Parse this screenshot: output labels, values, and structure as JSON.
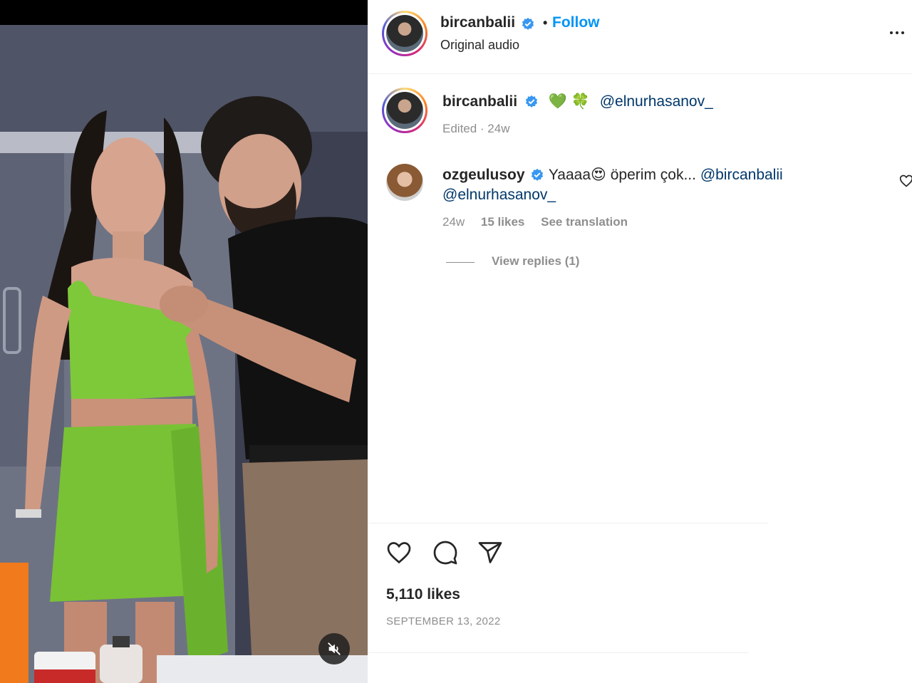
{
  "header": {
    "username": "bircanbalii",
    "separator": "•",
    "follow_label": "Follow",
    "audio": "Original audio"
  },
  "caption": {
    "username": "bircanbalii",
    "emojis": "💚 🍀",
    "mention": "@elnurhasanov_",
    "meta": "Edited · 24w"
  },
  "comment": {
    "username": "ozgeulusoy",
    "text_before": "Yaaaa",
    "emoji": "😍",
    "text_after": "öperim çok...",
    "mention1": "@bircanbalii",
    "mention2": "@elnurhasanov_",
    "time": "24w",
    "likes": "15 likes",
    "see_translation": "See translation",
    "view_replies": "View replies (1)"
  },
  "post": {
    "likes": "5,110 likes",
    "date": "SEPTEMBER 13, 2022"
  },
  "colors": {
    "accent": "#0095f6",
    "mention": "#00376b",
    "muted": "#8e8e8e",
    "verified": "#3897f0"
  },
  "icons": [
    "verified-badge-icon",
    "more-icon",
    "heart-icon",
    "comment-icon",
    "share-icon",
    "muted-speaker-icon"
  ]
}
